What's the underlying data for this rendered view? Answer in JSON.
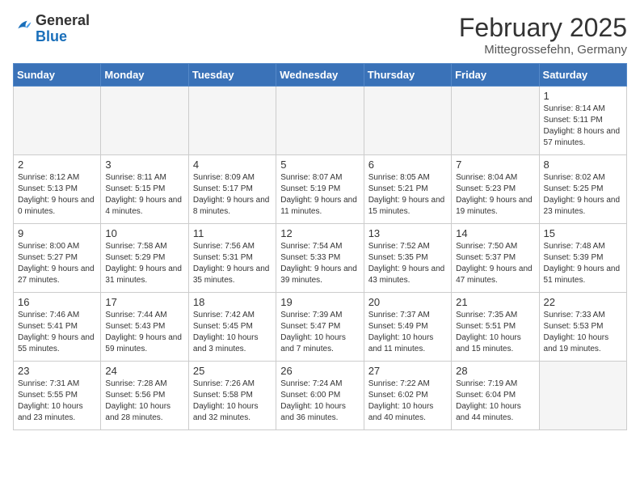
{
  "header": {
    "logo": {
      "general": "General",
      "blue": "Blue"
    },
    "title": "February 2025",
    "location": "Mittegrossefehn, Germany"
  },
  "weekdays": [
    "Sunday",
    "Monday",
    "Tuesday",
    "Wednesday",
    "Thursday",
    "Friday",
    "Saturday"
  ],
  "weeks": [
    [
      {
        "day": "",
        "info": ""
      },
      {
        "day": "",
        "info": ""
      },
      {
        "day": "",
        "info": ""
      },
      {
        "day": "",
        "info": ""
      },
      {
        "day": "",
        "info": ""
      },
      {
        "day": "",
        "info": ""
      },
      {
        "day": "1",
        "info": "Sunrise: 8:14 AM\nSunset: 5:11 PM\nDaylight: 8 hours and 57 minutes."
      }
    ],
    [
      {
        "day": "2",
        "info": "Sunrise: 8:12 AM\nSunset: 5:13 PM\nDaylight: 9 hours and 0 minutes."
      },
      {
        "day": "3",
        "info": "Sunrise: 8:11 AM\nSunset: 5:15 PM\nDaylight: 9 hours and 4 minutes."
      },
      {
        "day": "4",
        "info": "Sunrise: 8:09 AM\nSunset: 5:17 PM\nDaylight: 9 hours and 8 minutes."
      },
      {
        "day": "5",
        "info": "Sunrise: 8:07 AM\nSunset: 5:19 PM\nDaylight: 9 hours and 11 minutes."
      },
      {
        "day": "6",
        "info": "Sunrise: 8:05 AM\nSunset: 5:21 PM\nDaylight: 9 hours and 15 minutes."
      },
      {
        "day": "7",
        "info": "Sunrise: 8:04 AM\nSunset: 5:23 PM\nDaylight: 9 hours and 19 minutes."
      },
      {
        "day": "8",
        "info": "Sunrise: 8:02 AM\nSunset: 5:25 PM\nDaylight: 9 hours and 23 minutes."
      }
    ],
    [
      {
        "day": "9",
        "info": "Sunrise: 8:00 AM\nSunset: 5:27 PM\nDaylight: 9 hours and 27 minutes."
      },
      {
        "day": "10",
        "info": "Sunrise: 7:58 AM\nSunset: 5:29 PM\nDaylight: 9 hours and 31 minutes."
      },
      {
        "day": "11",
        "info": "Sunrise: 7:56 AM\nSunset: 5:31 PM\nDaylight: 9 hours and 35 minutes."
      },
      {
        "day": "12",
        "info": "Sunrise: 7:54 AM\nSunset: 5:33 PM\nDaylight: 9 hours and 39 minutes."
      },
      {
        "day": "13",
        "info": "Sunrise: 7:52 AM\nSunset: 5:35 PM\nDaylight: 9 hours and 43 minutes."
      },
      {
        "day": "14",
        "info": "Sunrise: 7:50 AM\nSunset: 5:37 PM\nDaylight: 9 hours and 47 minutes."
      },
      {
        "day": "15",
        "info": "Sunrise: 7:48 AM\nSunset: 5:39 PM\nDaylight: 9 hours and 51 minutes."
      }
    ],
    [
      {
        "day": "16",
        "info": "Sunrise: 7:46 AM\nSunset: 5:41 PM\nDaylight: 9 hours and 55 minutes."
      },
      {
        "day": "17",
        "info": "Sunrise: 7:44 AM\nSunset: 5:43 PM\nDaylight: 9 hours and 59 minutes."
      },
      {
        "day": "18",
        "info": "Sunrise: 7:42 AM\nSunset: 5:45 PM\nDaylight: 10 hours and 3 minutes."
      },
      {
        "day": "19",
        "info": "Sunrise: 7:39 AM\nSunset: 5:47 PM\nDaylight: 10 hours and 7 minutes."
      },
      {
        "day": "20",
        "info": "Sunrise: 7:37 AM\nSunset: 5:49 PM\nDaylight: 10 hours and 11 minutes."
      },
      {
        "day": "21",
        "info": "Sunrise: 7:35 AM\nSunset: 5:51 PM\nDaylight: 10 hours and 15 minutes."
      },
      {
        "day": "22",
        "info": "Sunrise: 7:33 AM\nSunset: 5:53 PM\nDaylight: 10 hours and 19 minutes."
      }
    ],
    [
      {
        "day": "23",
        "info": "Sunrise: 7:31 AM\nSunset: 5:55 PM\nDaylight: 10 hours and 23 minutes."
      },
      {
        "day": "24",
        "info": "Sunrise: 7:28 AM\nSunset: 5:56 PM\nDaylight: 10 hours and 28 minutes."
      },
      {
        "day": "25",
        "info": "Sunrise: 7:26 AM\nSunset: 5:58 PM\nDaylight: 10 hours and 32 minutes."
      },
      {
        "day": "26",
        "info": "Sunrise: 7:24 AM\nSunset: 6:00 PM\nDaylight: 10 hours and 36 minutes."
      },
      {
        "day": "27",
        "info": "Sunrise: 7:22 AM\nSunset: 6:02 PM\nDaylight: 10 hours and 40 minutes."
      },
      {
        "day": "28",
        "info": "Sunrise: 7:19 AM\nSunset: 6:04 PM\nDaylight: 10 hours and 44 minutes."
      },
      {
        "day": "",
        "info": ""
      }
    ]
  ]
}
